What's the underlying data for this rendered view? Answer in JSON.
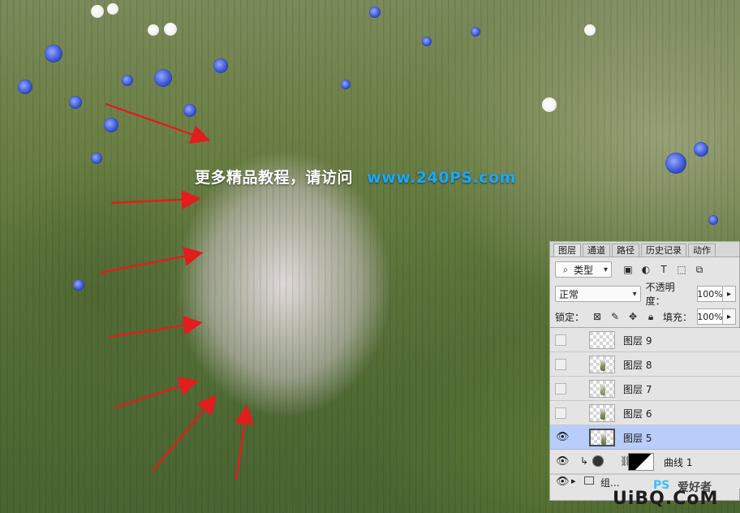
{
  "photo": {
    "watermark": {
      "cn": "更多精品教程，请访问",
      "url": "www.240PS.com"
    }
  },
  "panel": {
    "tabs": [
      "图层",
      "通道",
      "路径",
      "历史记录",
      "动作"
    ],
    "filter_kind": "类型",
    "blend_mode": "正常",
    "opacity_label": "不透明度：",
    "opacity_value": "100%",
    "lock_label": "锁定：",
    "fill_label": "填充：",
    "fill_value": "100%",
    "layers": [
      {
        "name": "图层 9"
      },
      {
        "name": "图层 8"
      },
      {
        "name": "图层 7"
      },
      {
        "name": "图层 6"
      },
      {
        "name": "图层 5"
      },
      {
        "name": "曲线 1"
      }
    ],
    "group_partial": "组..."
  },
  "site_mark": {
    "brand": "UiBQ.CoM",
    "ps": "PS",
    "cn": "爱好者"
  }
}
